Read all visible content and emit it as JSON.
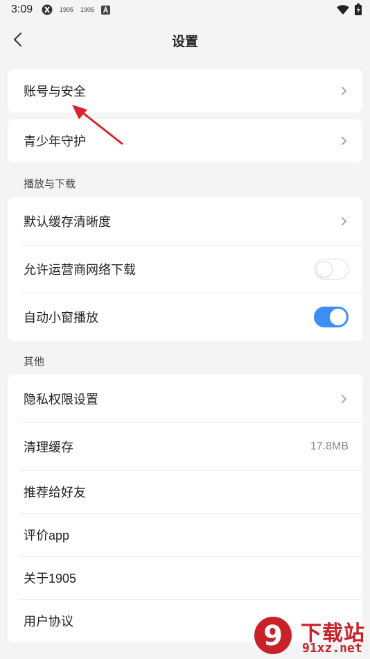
{
  "status_bar": {
    "time": "3:09",
    "left_icons": [
      "1905",
      "1905"
    ]
  },
  "header": {
    "title": "设置"
  },
  "account_card": {
    "account_security": "账号与安全"
  },
  "youth_card": {
    "youth_protection": "青少年守护"
  },
  "playback_section": {
    "title": "播放与下载",
    "default_quality": "默认缓存清晰度",
    "allow_carrier_download": {
      "label": "允许运营商网络下载",
      "enabled": false
    },
    "auto_pip": {
      "label": "自动小窗播放",
      "enabled": true
    }
  },
  "other_section": {
    "title": "其他",
    "privacy_settings": "隐私权限设置",
    "clear_cache": {
      "label": "清理缓存",
      "value": "17.8MB"
    },
    "recommend_friends": "推荐给好友",
    "rate_app": "评价app",
    "about": "关于1905",
    "user_agreement": "用户协议"
  },
  "watermark": {
    "title": "下载站",
    "url": "91xz.net",
    "logo_text": "9"
  },
  "colors": {
    "accent": "#3d8ef0",
    "annotation_arrow": "#d9232b",
    "watermark": "#c9212a"
  }
}
